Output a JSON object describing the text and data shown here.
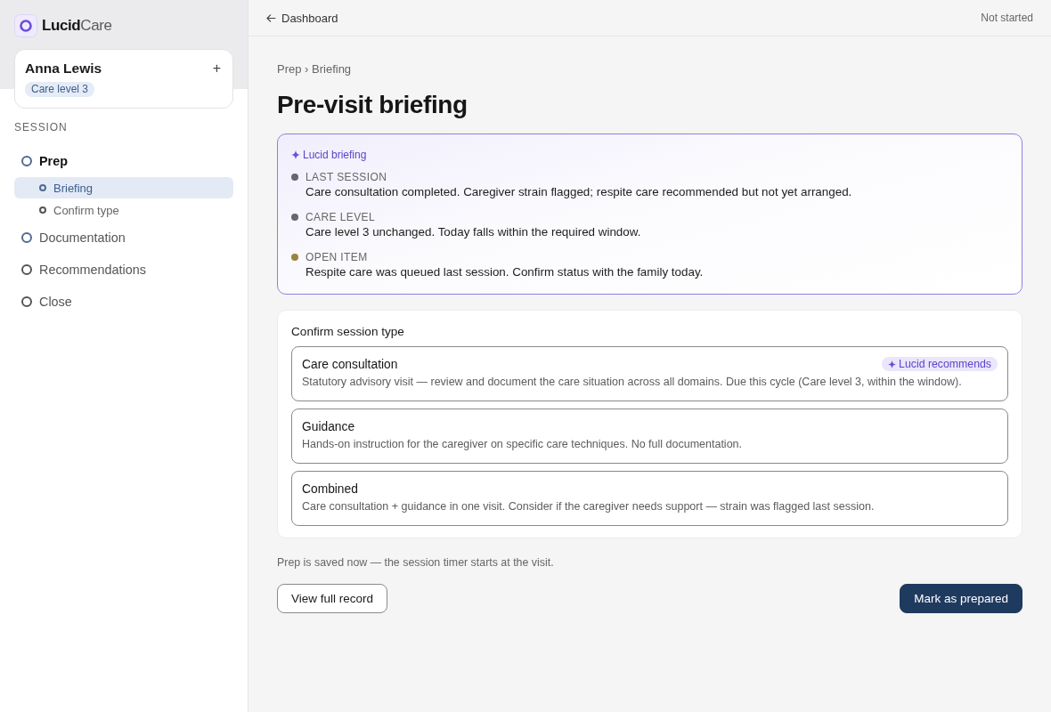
{
  "sidebar": {
    "logo": {
      "bold": "Lucid",
      "light": "Care"
    },
    "patient": {
      "name": "Anna Lewis",
      "action": "+",
      "badge": "Care level 3"
    },
    "section_label": "SESSION",
    "steps": [
      {
        "label": "Prep",
        "selected": true,
        "color": "#4f6b93",
        "children": [
          {
            "label": "Briefing",
            "selected": true,
            "color": "#4f6b93"
          },
          {
            "label": "Confirm type",
            "selected": false,
            "color": "#555555"
          }
        ]
      },
      {
        "label": "Documentation",
        "selected": false,
        "color": "#4f6b93"
      },
      {
        "label": "Recommendations",
        "selected": false,
        "color": "#555555"
      },
      {
        "label": "Close",
        "selected": false,
        "color": "#555555"
      }
    ]
  },
  "topbar": {
    "back": "Dashboard",
    "status": "Not started"
  },
  "breadcrumb": "Prep › Briefing",
  "title": "Pre-visit briefing",
  "briefing": {
    "header": "Lucid briefing",
    "items": [
      {
        "label": "LAST SESSION",
        "text": "Care consultation completed. Caregiver strain flagged; respite care recommended but not yet arranged.",
        "color": "#66666e"
      },
      {
        "label": "CARE LEVEL",
        "text": "Care level 3 unchanged. Today falls within the required window.",
        "color": "#66666e"
      },
      {
        "label": "OPEN ITEM",
        "text": "Respite care was queued last session. Confirm status with the family today.",
        "color": "#9a8342"
      }
    ]
  },
  "session_type": {
    "title": "Confirm session type",
    "options": [
      {
        "title": "Care consultation",
        "description": "Statutory advisory visit — review and document the care situation across all domains. Due this cycle (Care level 3, within the window).",
        "badge": "Lucid recommends"
      },
      {
        "title": "Guidance",
        "description": "Hands-on instruction for the caregiver on specific care techniques. No full documentation."
      },
      {
        "title": "Combined",
        "description": "Care consultation + guidance in one visit. Consider if the caregiver needs support — strain was flagged last session."
      }
    ]
  },
  "note": "Prep is saved now — the session timer starts at the visit.",
  "buttons": [
    {
      "label": "View full record",
      "kind": "secondary"
    },
    {
      "label": "Mark as prepared",
      "kind": "primary"
    }
  ]
}
